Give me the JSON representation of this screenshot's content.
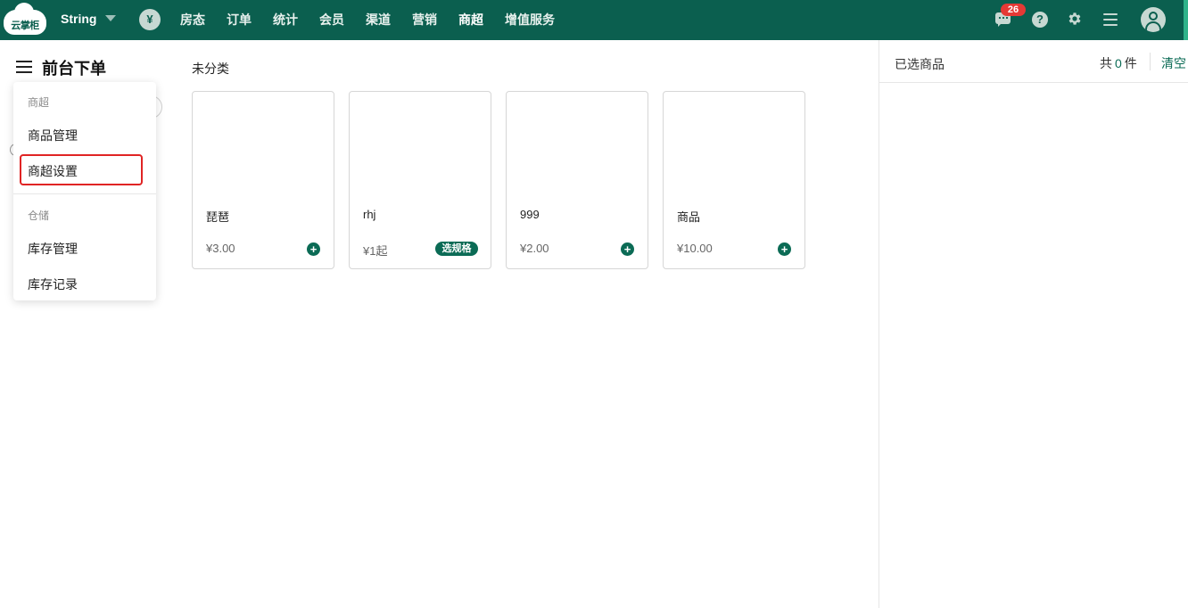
{
  "topbar": {
    "logo_text": "云掌柜",
    "brand": "String",
    "currency_symbol": "¥",
    "nav": [
      "房态",
      "订单",
      "统计",
      "会员",
      "渠道",
      "营销",
      "商超",
      "增值服务"
    ],
    "active_nav": "商超",
    "message_count": "26",
    "help_symbol": "?"
  },
  "page": {
    "title": "前台下单"
  },
  "dropdown": {
    "group1_label": "商超",
    "item_goods_mgmt": "商品管理",
    "item_shop_settings": "商超设置",
    "group2_label": "仓储",
    "item_stock_mgmt": "库存管理",
    "item_stock_records": "库存记录",
    "highlighted_item": "商超设置"
  },
  "category": "未分类",
  "products": [
    {
      "name": "琵琶",
      "price": "¥3.00",
      "action": "add"
    },
    {
      "name": "rhj",
      "price": "¥1起",
      "action": "选规格"
    },
    {
      "name": "999",
      "price": "¥2.00",
      "action": "add"
    },
    {
      "name": "商品",
      "price": "¥10.00",
      "action": "add"
    }
  ],
  "selected_panel": {
    "title": "已选商品",
    "count_prefix": "共",
    "count": "0",
    "count_suffix": "件",
    "clear_label": "清空"
  },
  "colors": {
    "topbar_bg": "#0b5f4f",
    "accent": "#0b6b55",
    "badge": "#e53935",
    "highlight_border": "#e02424"
  }
}
